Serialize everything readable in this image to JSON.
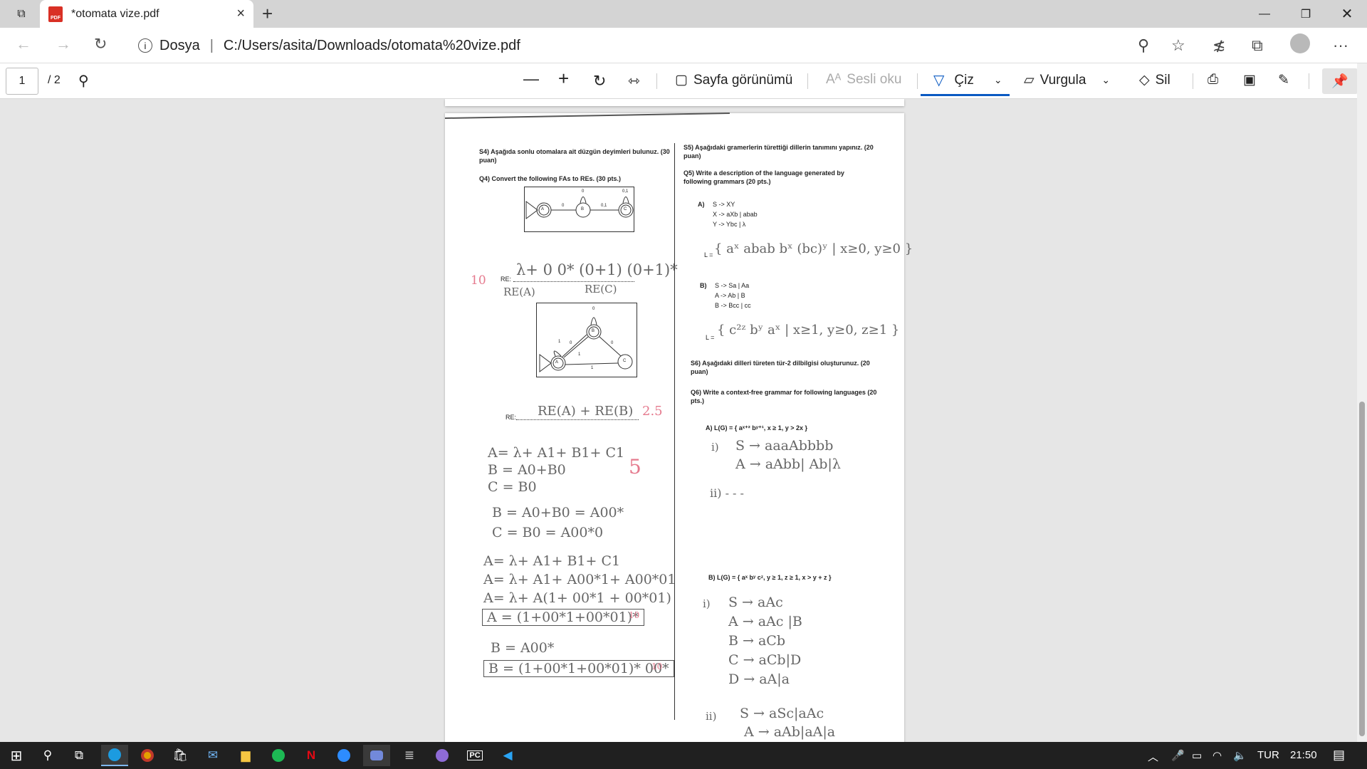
{
  "browser": {
    "tab_title": "*otomata vize.pdf",
    "tab_icon": "pdf-icon",
    "address_prefix": "Dosya",
    "address_separator": "|",
    "url": "C:/Users/asita/Downloads/otomata%20vize.pdf"
  },
  "pdf_toolbar": {
    "page_number": "1",
    "page_total": "/ 2",
    "page_view": "Sayfa görünümü",
    "read_aloud": "Sesli oku",
    "draw": "Çiz",
    "highlight": "Vurgula",
    "erase": "Sil"
  },
  "doc": {
    "s4_tr": "S4) Aşağıda sonlu otomalara ait düzgün deyimleri bulunuz. (30 puan)",
    "q4_en": "Q4) Convert the following FAs to REs. (30 pts.)",
    "re_label": "RE:",
    "s5_tr": "S5) Aşağıdaki gramerlerin türettiği dillerin tanımını yapınız. (20 puan)",
    "q5_en": "Q5) Write a description of the language generated by following grammars (20 pts.)",
    "a_label": "A)",
    "a_rules": [
      "S -> XY",
      "X -> aXb | abab",
      "Y -> Ybc | λ"
    ],
    "l_label": "L =",
    "b_label": "B)",
    "b_rules": [
      "S -> Sa | Aa",
      "A -> Ab | B",
      "B -> Bcc | cc"
    ],
    "s6_tr": "S6) Aşağıdaki dilleri türeten tür-2 dilbilgisi oluşturunuz. (20 puan)",
    "q6_en": "Q6) Write a context-free grammar for following languages (20 pts.)",
    "q6a": "A) L(G) = { aˣ⁺² bʸ⁺¹, x ≥ 1, y > 2x }",
    "q6b": "B) L(G) = { aˣ bʸ cᶻ, y ≥ 1, z ≥ 1, x > y + z }",
    "fa1_states": [
      "A",
      "B",
      "C"
    ],
    "fa1_edge_labels": [
      "0",
      "0",
      "0,1",
      "0,1"
    ],
    "fa2_states": [
      "A",
      "B",
      "C"
    ],
    "fa2_edge_labels": [
      "0",
      "1",
      "0",
      "1",
      "0",
      "1"
    ]
  },
  "handwriting": {
    "re1": "λ+ 0 0* (0+1) (0+1)*",
    "re1_sub": [
      "RE(A)",
      "RE(C)"
    ],
    "score_10": "10",
    "re2": "RE(A) + RE(B)",
    "score_2_5": "2.5",
    "score_5": "5",
    "eq_lines": [
      "A= λ+ A1+ B1+ C1",
      "B = A0+B0",
      "C = B0"
    ],
    "eq2": [
      "B = A0+B0 = A00*",
      "C = B0 = A00*0"
    ],
    "eq3": [
      "A= λ+ A1+ B1+ C1",
      "A= λ+ A1+ A00*1+ A00*01",
      "A= λ+ A(1+ 00*1 + 00*01)"
    ],
    "boxed_a": "A = (1+00*1+00*01)*",
    "score_10b": "10",
    "b_eq": "B = A00*",
    "boxed_b": "B = (1+00*1+00*01)* 00*",
    "score_10c": "10",
    "l_a": "{ aˣ abab bˣ (bc)ʸ | x≥0, y≥0 }",
    "l_b": "{ c²ᶻ bʸ aˣ | x≥1, y≥0, z≥1 }",
    "g_a_i": "i)",
    "g_a": [
      "S → aaaAbbbb",
      "A → aAbb| Ab|λ"
    ],
    "g_a_ii": "ii)   - - -",
    "g_b_i": "i)",
    "g_b": [
      "S → aAc",
      "A → aAc |B",
      "B → aCb",
      "C → aCb|D",
      "D → aA|a"
    ],
    "g_b_ii": "ii)",
    "g_b2": [
      "S → aSc|aAc",
      "A → aAb|aA|a"
    ]
  },
  "taskbar": {
    "lang": "TUR",
    "time": "21:50"
  },
  "colors": {
    "accent": "#0a5ac2",
    "grade": "#e57a8e",
    "taskbar": "#202020"
  }
}
